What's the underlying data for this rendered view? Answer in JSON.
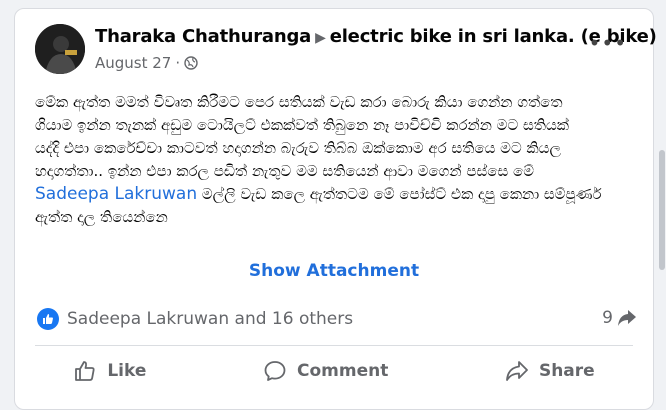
{
  "post": {
    "author": "Tharaka Chathuranga",
    "group": "electric bike in sri lanka. (e bike)",
    "date": "August 27",
    "privacy_dot": "·",
    "more_label": "•••",
    "lines": [
      "මේක ඇත්ත මමත් විවෘත කිරීමට පෙර සතියක් වැඩ කරා බොරු කියා ගෙන්න ගත්තෙ",
      "ගියාම ඉන්න තැනක් අඩුම ටොයිලට් එකක්වත් තිබුනෙ නෑ පාවිච්චි කරන්න මට සතියක්",
      "යද්දි එපා කෙරේච්චා කාටවත් හදාගන්න බැරුව තිබ්බ ඔක්කොම අර සතියෙ මට කියල",
      "හදාගත්තා.. ඉන්න එපා කරල පඩිත් නැතුව මම සතියෙන් ආවා මගෙන් පස්සෙ මේ"
    ],
    "mention": "Sadeepa Lakruwan",
    "line5_rest": " මල්ලි වැඩ කලෙ ඇත්තටම මේ පෝස්ට් එක දාපු කෙනා සම්පූර්ණ",
    "line6": "ඇත්ත දාල තියෙන්නෙ",
    "show_attachment": "Show Attachment"
  },
  "reactions": {
    "summary": "Sadeepa Lakruwan and 16 others",
    "share_count": "9"
  },
  "actions": {
    "like": "Like",
    "comment": "Comment",
    "share": "Share"
  },
  "colors": {
    "link": "#216fdb",
    "like_blue": "#1877f2",
    "muted": "#65676b"
  }
}
